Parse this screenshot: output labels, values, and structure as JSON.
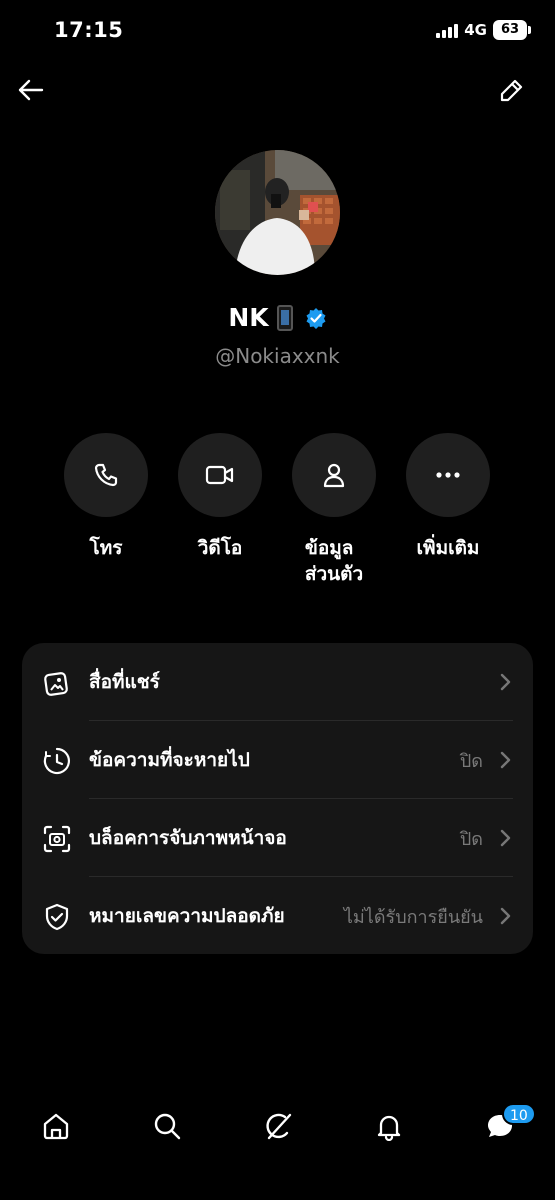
{
  "status_bar": {
    "time": "17:15",
    "network": "4G",
    "battery": "63"
  },
  "topbar": {
    "back_icon": "arrow-left-icon",
    "edit_icon": "pencil-icon"
  },
  "profile": {
    "name": "NK",
    "emoji": "mobile-phone-emoji",
    "verified_icon": "verified-badge-icon",
    "handle": "@Nokiaxxnk",
    "accent_color": "#1d9bf0"
  },
  "actions": [
    {
      "label": "โทร",
      "icon": "phone-icon"
    },
    {
      "label": "วิดีโอ",
      "icon": "video-camera-icon"
    },
    {
      "label": "ข้อมูล\nส่วนตัว",
      "label_line1": "ข้อมูล",
      "label_line2": "ส่วนตัว",
      "icon": "person-icon"
    },
    {
      "label": "เพิ่มเติม",
      "icon": "more-icon"
    }
  ],
  "settings": [
    {
      "label": "สื่อที่แชร์",
      "value": "",
      "icon": "shared-media-icon"
    },
    {
      "label": "ข้อความที่จะหายไป",
      "value": "ปิด",
      "icon": "disappearing-messages-icon"
    },
    {
      "label": "บล็อคการจับภาพหน้าจอ",
      "value": "ปิด",
      "icon": "screenshot-block-icon"
    },
    {
      "label": "หมายเลขความปลอดภัย",
      "value": "ไม่ได้รับการยืนยัน",
      "icon": "shield-check-icon"
    }
  ],
  "bottom_nav": {
    "items": [
      "home-icon",
      "search-icon",
      "grok-icon",
      "notifications-icon",
      "messages-icon"
    ],
    "messages_badge": "10"
  }
}
